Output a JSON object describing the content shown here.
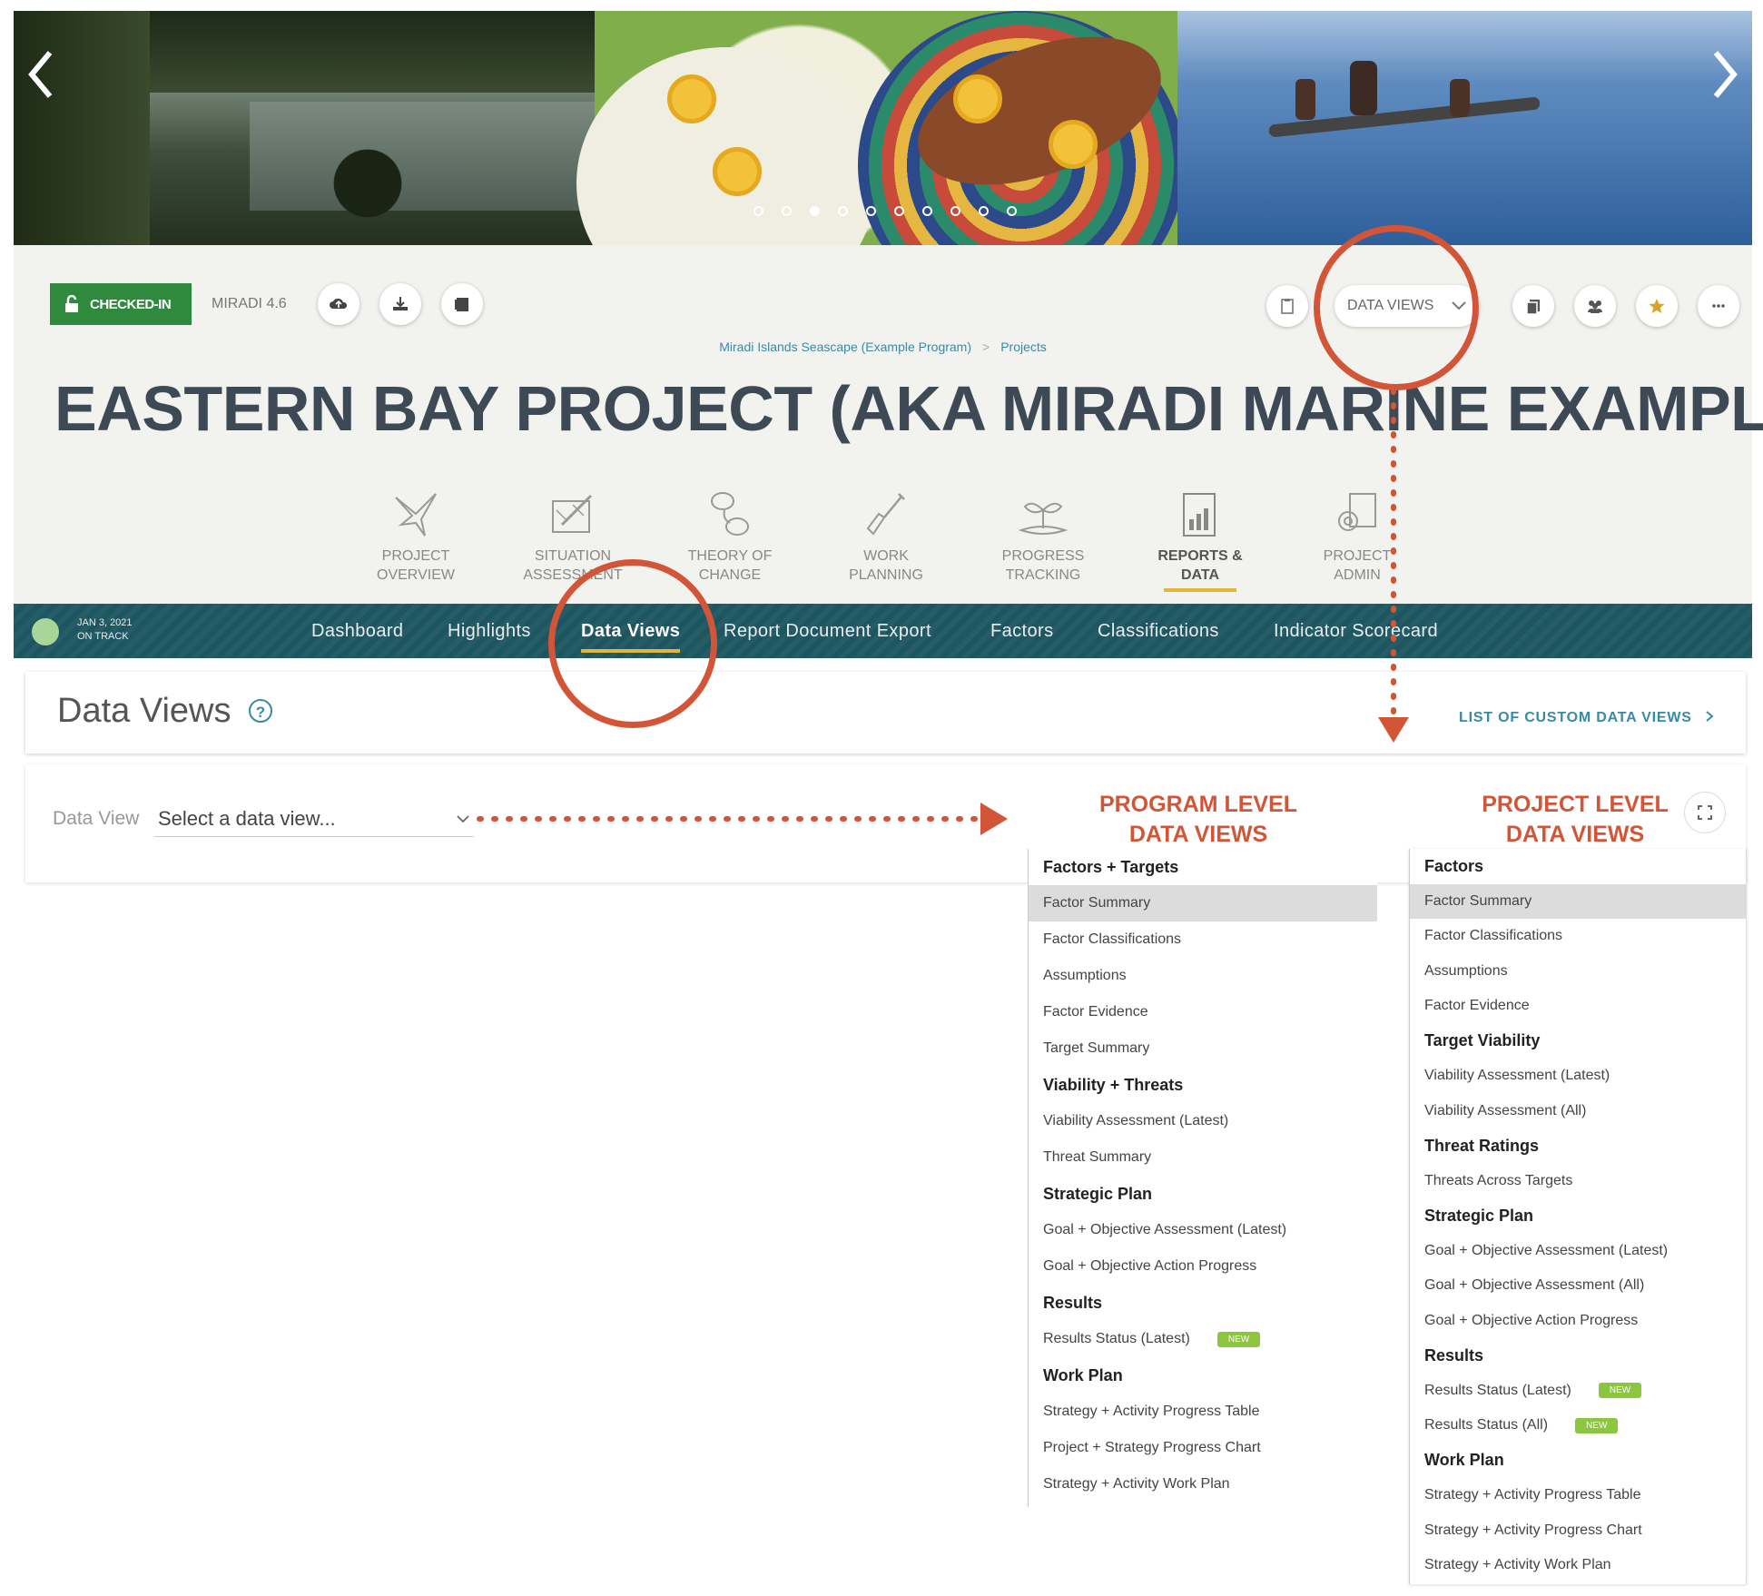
{
  "toolbar": {
    "status_label": "CHECKED-IN",
    "version": "MIRADI 4.6",
    "data_views_dropdown": "DATA VIEWS"
  },
  "breadcrumb": {
    "program": "Miradi Islands Seascape (Example Program)",
    "separator": ">",
    "projects": "Projects"
  },
  "project_title": "EASTERN BAY PROJECT (AKA MIRADI MARINE EXAMPLE)",
  "modules": [
    {
      "line1": "PROJECT",
      "line2": "OVERVIEW"
    },
    {
      "line1": "SITUATION",
      "line2": "ASSESSMENT"
    },
    {
      "line1": "THEORY OF",
      "line2": "CHANGE"
    },
    {
      "line1": "WORK",
      "line2": "PLANNING"
    },
    {
      "line1": "PROGRESS",
      "line2": "TRACKING"
    },
    {
      "line1": "REPORTS &",
      "line2": "DATA"
    },
    {
      "line1": "PROJECT",
      "line2": "ADMIN"
    }
  ],
  "status": {
    "date": "JAN 3, 2021",
    "state": "ON TRACK"
  },
  "tabs": [
    "Dashboard",
    "Highlights",
    "Data Views",
    "Report Document Export",
    "Factors",
    "Classifications",
    "Indicator Scorecard"
  ],
  "page": {
    "title": "Data Views",
    "help": "?",
    "custom_link": "LIST OF CUSTOM DATA VIEWS",
    "field_label": "Data View",
    "select_placeholder": "Select a data view..."
  },
  "annotations": {
    "program_line1": "PROGRAM LEVEL",
    "program_line2": "DATA VIEWS",
    "project_line1": "PROJECT LEVEL",
    "project_line2": "DATA VIEWS"
  },
  "program_list": [
    {
      "label": "Factors + Targets",
      "type": "head"
    },
    {
      "label": "Factor Summary",
      "type": "selected"
    },
    {
      "label": "Factor Classifications",
      "type": "item"
    },
    {
      "label": "Assumptions",
      "type": "item"
    },
    {
      "label": "Factor Evidence",
      "type": "item"
    },
    {
      "label": "Target Summary",
      "type": "item"
    },
    {
      "label": "Viability + Threats",
      "type": "head"
    },
    {
      "label": "Viability Assessment (Latest)",
      "type": "item"
    },
    {
      "label": "Threat Summary",
      "type": "item"
    },
    {
      "label": "Strategic Plan",
      "type": "head"
    },
    {
      "label": "Goal + Objective Assessment (Latest)",
      "type": "item"
    },
    {
      "label": "Goal + Objective Action Progress",
      "type": "item"
    },
    {
      "label": "Results",
      "type": "head"
    },
    {
      "label": "Results Status (Latest)",
      "type": "item",
      "badge": "NEW"
    },
    {
      "label": "Work Plan",
      "type": "head"
    },
    {
      "label": "Strategy + Activity Progress Table",
      "type": "item"
    },
    {
      "label": "Project + Strategy Progress Chart",
      "type": "item"
    },
    {
      "label": "Strategy + Activity Work Plan",
      "type": "item"
    }
  ],
  "project_list": [
    {
      "label": "Factors",
      "type": "head"
    },
    {
      "label": "Factor Summary",
      "type": "selected"
    },
    {
      "label": "Factor Classifications",
      "type": "item"
    },
    {
      "label": "Assumptions",
      "type": "item"
    },
    {
      "label": "Factor Evidence",
      "type": "item"
    },
    {
      "label": "Target Viability",
      "type": "head"
    },
    {
      "label": "Viability Assessment (Latest)",
      "type": "item"
    },
    {
      "label": "Viability Assessment (All)",
      "type": "item"
    },
    {
      "label": "Threat Ratings",
      "type": "head"
    },
    {
      "label": "Threats Across Targets",
      "type": "item"
    },
    {
      "label": "Strategic Plan",
      "type": "head"
    },
    {
      "label": "Goal + Objective Assessment (Latest)",
      "type": "item"
    },
    {
      "label": "Goal + Objective Assessment (All)",
      "type": "item"
    },
    {
      "label": "Goal + Objective Action Progress",
      "type": "item"
    },
    {
      "label": "Results",
      "type": "head"
    },
    {
      "label": "Results Status (Latest)",
      "type": "item",
      "badge": "NEW"
    },
    {
      "label": "Results Status (All)",
      "type": "item",
      "badge": "NEW"
    },
    {
      "label": "Work Plan",
      "type": "head"
    },
    {
      "label": "Strategy + Activity Progress Table",
      "type": "item"
    },
    {
      "label": "Strategy + Activity Progress Chart",
      "type": "item"
    },
    {
      "label": "Strategy + Activity Work Plan",
      "type": "item"
    }
  ],
  "colors": {
    "accent_orange": "#d35537",
    "teal_bar": "#1d5560",
    "checked_in_green": "#2f8a3e",
    "active_underline": "#e4b53b",
    "badge_green": "#8cc63f"
  }
}
